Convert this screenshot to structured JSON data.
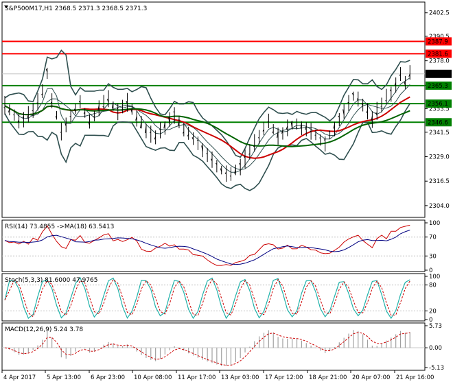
{
  "main": {
    "header": "S&P500M17,H1  2368.5 2371.3 2368.5 2371.3",
    "price_ticks": [
      "2402.5",
      "2390.5",
      "2378.0",
      "2365.5",
      "2353.5",
      "2341.5",
      "2329.0",
      "2316.5",
      "2304.0"
    ],
    "level_labels": [
      {
        "text": "2387.9",
        "color": "#ff0000"
      },
      {
        "text": "2381.6",
        "color": "#ff0000"
      },
      {
        "text": "2371.3",
        "color": "#000000"
      },
      {
        "text": "2365.3",
        "color": "#008000"
      },
      {
        "text": "2356.1",
        "color": "#008000"
      },
      {
        "text": "2346.6",
        "color": "#008000"
      }
    ]
  },
  "rsi": {
    "header": "RSI(14) 73.4855  ->MA(18) 63.5413",
    "ticks": [
      "100",
      "70",
      "30",
      "0"
    ]
  },
  "stoch": {
    "header": "Stoch(5,3,3) 81.6000 47.9765",
    "ticks": [
      "100",
      "80",
      "20",
      "0"
    ]
  },
  "macd": {
    "header": "MACD(12,26,9) 5.24 3.78",
    "ticks": [
      "5.73",
      "0.00",
      "-5.13"
    ]
  },
  "time_labels": [
    "4 Apr 2017",
    "5 Apr 13:00",
    "6 Apr 23:00",
    "10 Apr 08:00",
    "11 Apr 17:00",
    "13 Apr 03:00",
    "17 Apr 12:00",
    "18 Apr 21:00",
    "20 Apr 07:00",
    "21 Apr 16:00"
  ],
  "chart_data": {
    "type": "line",
    "symbol": "S&P500M17",
    "timeframe": "H1",
    "ohlc_last": {
      "open": 2368.5,
      "high": 2371.3,
      "low": 2368.5,
      "close": 2371.3
    },
    "price_axis": {
      "min": 2304.0,
      "max": 2402.5
    },
    "horizontal_levels": [
      {
        "value": 2387.9,
        "color": "#ff0000"
      },
      {
        "value": 2381.6,
        "color": "#ff0000"
      },
      {
        "value": 2365.3,
        "color": "#008000"
      },
      {
        "value": 2356.1,
        "color": "#008000"
      },
      {
        "value": 2346.6,
        "color": "#008000"
      }
    ],
    "current_price": 2371.3,
    "price_series": [
      [
        0,
        2355
      ],
      [
        3,
        2347
      ],
      [
        6,
        2352
      ],
      [
        8,
        2362
      ],
      [
        9,
        2372
      ],
      [
        10,
        2358
      ],
      [
        12,
        2342
      ],
      [
        14,
        2350
      ],
      [
        16,
        2356
      ],
      [
        18,
        2346
      ],
      [
        20,
        2354
      ],
      [
        22,
        2358
      ],
      [
        24,
        2352
      ],
      [
        26,
        2357
      ],
      [
        28,
        2348
      ],
      [
        30,
        2343
      ],
      [
        32,
        2339
      ],
      [
        34,
        2345
      ],
      [
        36,
        2350
      ],
      [
        38,
        2342
      ],
      [
        40,
        2338
      ],
      [
        42,
        2333
      ],
      [
        44,
        2328
      ],
      [
        46,
        2322
      ],
      [
        48,
        2320
      ],
      [
        50,
        2324
      ],
      [
        52,
        2332
      ],
      [
        54,
        2340
      ],
      [
        56,
        2346
      ],
      [
        58,
        2340
      ],
      [
        60,
        2344
      ],
      [
        62,
        2346
      ],
      [
        64,
        2343
      ],
      [
        66,
        2340
      ],
      [
        68,
        2336
      ],
      [
        70,
        2344
      ],
      [
        72,
        2352
      ],
      [
        74,
        2360
      ],
      [
        76,
        2356
      ],
      [
        78,
        2348
      ],
      [
        80,
        2356
      ],
      [
        82,
        2362
      ],
      [
        84,
        2370
      ],
      [
        85,
        2367
      ],
      [
        86,
        2371
      ]
    ],
    "rsi": {
      "period": 14,
      "value": 73.4855,
      "ma_period": 18,
      "ma_value": 63.5413,
      "levels": [
        70,
        30
      ],
      "range": [
        0,
        100
      ]
    },
    "stochastic": {
      "k": 5,
      "d": 3,
      "slowing": 3,
      "k_value": 81.6,
      "d_value": 47.9765,
      "levels": [
        80,
        20
      ],
      "range": [
        0,
        100
      ]
    },
    "macd": {
      "fast": 12,
      "slow": 26,
      "signal": 9,
      "macd_value": 5.24,
      "signal_value": 3.78,
      "range": [
        -5.13,
        5.73
      ]
    }
  }
}
